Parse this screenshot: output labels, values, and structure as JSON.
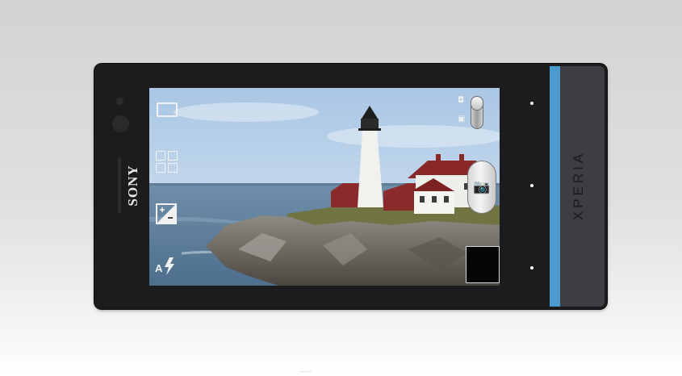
{
  "device": {
    "brand": "SONY",
    "model": "XPERIA",
    "accent_color": "#4a9ad0",
    "body_color": "#1c1c1e"
  },
  "camera_ui": {
    "left_controls": [
      {
        "name": "aspect-ratio",
        "icon": "aspect-ratio-icon"
      },
      {
        "name": "scenes",
        "icon": "grid-icon"
      },
      {
        "name": "exposure",
        "icon": "exposure-icon"
      },
      {
        "name": "flash",
        "icon": "auto-flash-icon",
        "label": "A"
      }
    ],
    "mode_toggle": {
      "photo_icon": "camera-icon",
      "video_icon": "video-icon",
      "selected": "photo"
    },
    "shutter": {
      "icon": "camera-icon"
    },
    "last_photo": {
      "icon": "thumbnail"
    }
  },
  "nav_buttons": [
    {
      "name": "nav-dot-top"
    },
    {
      "name": "nav-dot-middle"
    },
    {
      "name": "nav-dot-bottom"
    }
  ]
}
